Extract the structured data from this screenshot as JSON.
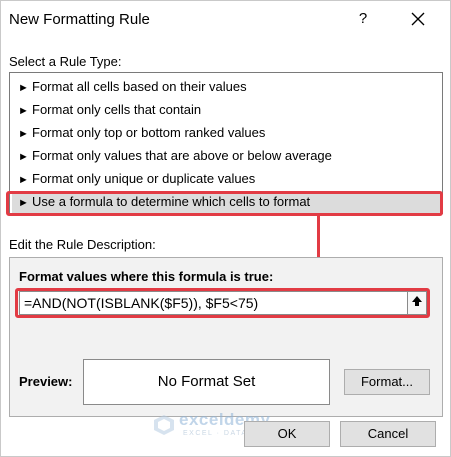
{
  "dialog": {
    "title": "New Formatting Rule",
    "help_label": "?",
    "close_icon": "close-icon"
  },
  "rule_type": {
    "label": "Select a Rule Type:",
    "arrow": "►",
    "items": [
      "Format all cells based on their values",
      "Format only cells that contain",
      "Format only top or bottom ranked values",
      "Format only values that are above or below average",
      "Format only unique or duplicate values",
      "Use a formula to determine which cells to format"
    ],
    "selected_index": 5
  },
  "description": {
    "label": "Edit the Rule Description:",
    "heading": "Format values where this formula is true:",
    "formula_value": "=AND(NOT(ISBLANK($F5)), $F5<75)",
    "collapse_icon": "collapse-dialog-icon",
    "preview_label": "Preview:",
    "preview_text": "No Format Set",
    "format_button": "Format..."
  },
  "footer": {
    "ok_label": "OK",
    "cancel_label": "Cancel"
  },
  "watermark": {
    "name": "exceldemy",
    "tagline": "EXCEL · DATA · BI"
  },
  "colors": {
    "highlight": "#e23b44",
    "selected_row": "#dcdcdc",
    "panel_bg": "#f2f2f2"
  }
}
